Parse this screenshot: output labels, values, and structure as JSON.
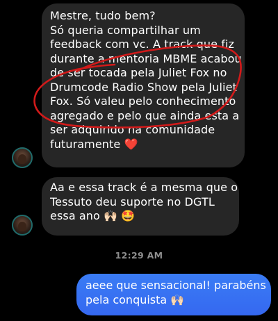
{
  "messages": [
    {
      "direction": "incoming",
      "lines": [
        "Mestre, tudo bem?",
        "Só queria compartilhar um",
        "feedback com vc. A track que fiz",
        "durante a mentoria MBME acabou",
        "de ser tocada pela Juliet Fox  no",
        "Drumcode Radio Show pela Juliet",
        "Fox. Só valeu pelo conhecimento",
        "agregado e pelo que ainda esta a",
        "ser adquirido na comunidade",
        "futuramente ❤️"
      ]
    },
    {
      "direction": "incoming",
      "lines": [
        "Aa e essa track é a mesma que o",
        "Tessuto deu suporte no DGTL",
        "essa ano 🙌🏻 🤩"
      ]
    },
    {
      "direction": "outgoing",
      "lines": [
        "aeee que sensacional! parabéns",
        "pela conquista 🙌🏻"
      ]
    }
  ],
  "timestamp": "12:29 AM",
  "colors": {
    "background": "#000000",
    "incoming_bubble": "#262626",
    "outgoing_bubble": "#3568f0",
    "annotation": "#d11a1a",
    "timestamp": "#8e8e8e"
  }
}
